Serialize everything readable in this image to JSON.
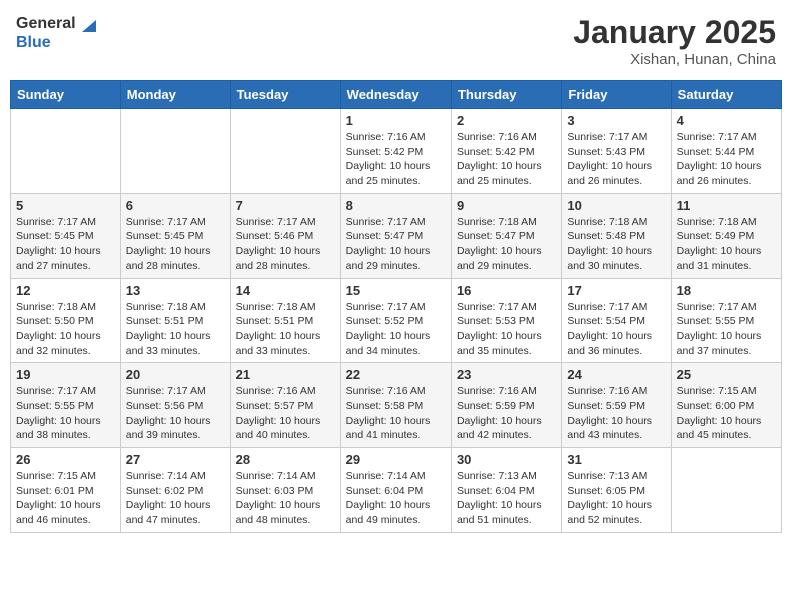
{
  "header": {
    "logo_general": "General",
    "logo_blue": "Blue",
    "title": "January 2025",
    "location": "Xishan, Hunan, China"
  },
  "weekdays": [
    "Sunday",
    "Monday",
    "Tuesday",
    "Wednesday",
    "Thursday",
    "Friday",
    "Saturday"
  ],
  "weeks": [
    [
      {
        "day": "",
        "info": ""
      },
      {
        "day": "",
        "info": ""
      },
      {
        "day": "",
        "info": ""
      },
      {
        "day": "1",
        "info": "Sunrise: 7:16 AM\nSunset: 5:42 PM\nDaylight: 10 hours\nand 25 minutes."
      },
      {
        "day": "2",
        "info": "Sunrise: 7:16 AM\nSunset: 5:42 PM\nDaylight: 10 hours\nand 25 minutes."
      },
      {
        "day": "3",
        "info": "Sunrise: 7:17 AM\nSunset: 5:43 PM\nDaylight: 10 hours\nand 26 minutes."
      },
      {
        "day": "4",
        "info": "Sunrise: 7:17 AM\nSunset: 5:44 PM\nDaylight: 10 hours\nand 26 minutes."
      }
    ],
    [
      {
        "day": "5",
        "info": "Sunrise: 7:17 AM\nSunset: 5:45 PM\nDaylight: 10 hours\nand 27 minutes."
      },
      {
        "day": "6",
        "info": "Sunrise: 7:17 AM\nSunset: 5:45 PM\nDaylight: 10 hours\nand 28 minutes."
      },
      {
        "day": "7",
        "info": "Sunrise: 7:17 AM\nSunset: 5:46 PM\nDaylight: 10 hours\nand 28 minutes."
      },
      {
        "day": "8",
        "info": "Sunrise: 7:17 AM\nSunset: 5:47 PM\nDaylight: 10 hours\nand 29 minutes."
      },
      {
        "day": "9",
        "info": "Sunrise: 7:18 AM\nSunset: 5:47 PM\nDaylight: 10 hours\nand 29 minutes."
      },
      {
        "day": "10",
        "info": "Sunrise: 7:18 AM\nSunset: 5:48 PM\nDaylight: 10 hours\nand 30 minutes."
      },
      {
        "day": "11",
        "info": "Sunrise: 7:18 AM\nSunset: 5:49 PM\nDaylight: 10 hours\nand 31 minutes."
      }
    ],
    [
      {
        "day": "12",
        "info": "Sunrise: 7:18 AM\nSunset: 5:50 PM\nDaylight: 10 hours\nand 32 minutes."
      },
      {
        "day": "13",
        "info": "Sunrise: 7:18 AM\nSunset: 5:51 PM\nDaylight: 10 hours\nand 33 minutes."
      },
      {
        "day": "14",
        "info": "Sunrise: 7:18 AM\nSunset: 5:51 PM\nDaylight: 10 hours\nand 33 minutes."
      },
      {
        "day": "15",
        "info": "Sunrise: 7:17 AM\nSunset: 5:52 PM\nDaylight: 10 hours\nand 34 minutes."
      },
      {
        "day": "16",
        "info": "Sunrise: 7:17 AM\nSunset: 5:53 PM\nDaylight: 10 hours\nand 35 minutes."
      },
      {
        "day": "17",
        "info": "Sunrise: 7:17 AM\nSunset: 5:54 PM\nDaylight: 10 hours\nand 36 minutes."
      },
      {
        "day": "18",
        "info": "Sunrise: 7:17 AM\nSunset: 5:55 PM\nDaylight: 10 hours\nand 37 minutes."
      }
    ],
    [
      {
        "day": "19",
        "info": "Sunrise: 7:17 AM\nSunset: 5:55 PM\nDaylight: 10 hours\nand 38 minutes."
      },
      {
        "day": "20",
        "info": "Sunrise: 7:17 AM\nSunset: 5:56 PM\nDaylight: 10 hours\nand 39 minutes."
      },
      {
        "day": "21",
        "info": "Sunrise: 7:16 AM\nSunset: 5:57 PM\nDaylight: 10 hours\nand 40 minutes."
      },
      {
        "day": "22",
        "info": "Sunrise: 7:16 AM\nSunset: 5:58 PM\nDaylight: 10 hours\nand 41 minutes."
      },
      {
        "day": "23",
        "info": "Sunrise: 7:16 AM\nSunset: 5:59 PM\nDaylight: 10 hours\nand 42 minutes."
      },
      {
        "day": "24",
        "info": "Sunrise: 7:16 AM\nSunset: 5:59 PM\nDaylight: 10 hours\nand 43 minutes."
      },
      {
        "day": "25",
        "info": "Sunrise: 7:15 AM\nSunset: 6:00 PM\nDaylight: 10 hours\nand 45 minutes."
      }
    ],
    [
      {
        "day": "26",
        "info": "Sunrise: 7:15 AM\nSunset: 6:01 PM\nDaylight: 10 hours\nand 46 minutes."
      },
      {
        "day": "27",
        "info": "Sunrise: 7:14 AM\nSunset: 6:02 PM\nDaylight: 10 hours\nand 47 minutes."
      },
      {
        "day": "28",
        "info": "Sunrise: 7:14 AM\nSunset: 6:03 PM\nDaylight: 10 hours\nand 48 minutes."
      },
      {
        "day": "29",
        "info": "Sunrise: 7:14 AM\nSunset: 6:04 PM\nDaylight: 10 hours\nand 49 minutes."
      },
      {
        "day": "30",
        "info": "Sunrise: 7:13 AM\nSunset: 6:04 PM\nDaylight: 10 hours\nand 51 minutes."
      },
      {
        "day": "31",
        "info": "Sunrise: 7:13 AM\nSunset: 6:05 PM\nDaylight: 10 hours\nand 52 minutes."
      },
      {
        "day": "",
        "info": ""
      }
    ]
  ]
}
